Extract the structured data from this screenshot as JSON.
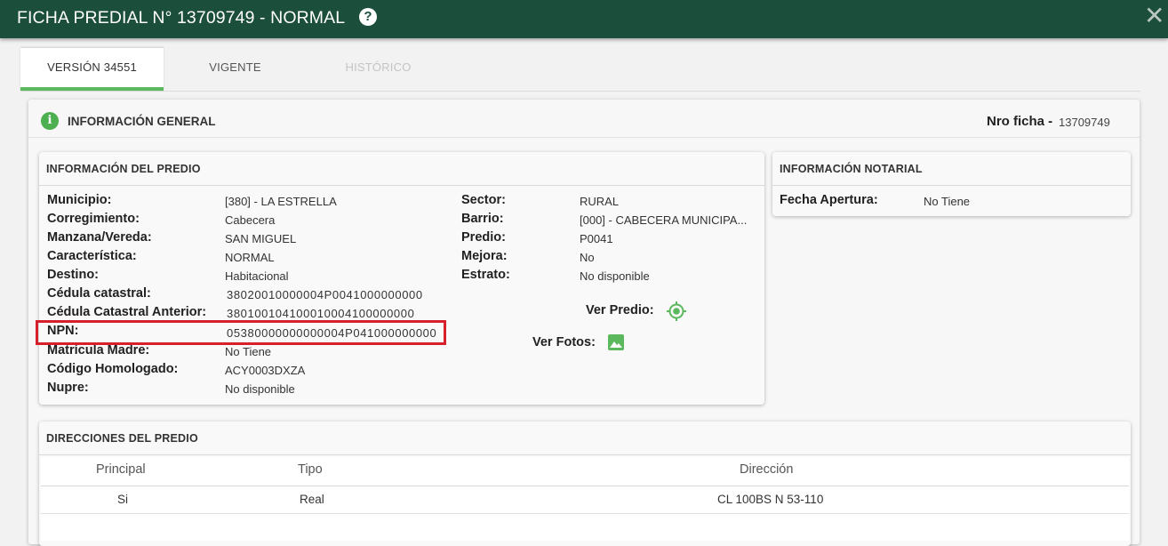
{
  "header": {
    "title": "FICHA PREDIAL N° 13709749 - NORMAL",
    "help_icon": "?",
    "close_icon": "✕"
  },
  "tabs": [
    {
      "label": "VERSIÓN 34551",
      "active": true
    },
    {
      "label": "VIGENTE",
      "active": false
    },
    {
      "label": "HISTÓRICO",
      "active": false,
      "disabled": true
    }
  ],
  "general": {
    "title": "INFORMACIÓN GENERAL",
    "icon": "info-icon",
    "nro_ficha_label": "Nro ficha -",
    "nro_ficha_value": "13709749"
  },
  "predio": {
    "title": "INFORMACIÓN DEL PREDIO",
    "left_fields": [
      {
        "label": "Municipio:",
        "value": "[380] - LA ESTRELLA"
      },
      {
        "label": "Corregimiento:",
        "value": "Cabecera"
      },
      {
        "label": "Manzana/Vereda:",
        "value": "SAN MIGUEL"
      },
      {
        "label": "Característica:",
        "value": "NORMAL"
      },
      {
        "label": "Destino:",
        "value": "Habitacional"
      },
      {
        "label": "Cédula catastral:",
        "value": "38020010000004P0041000000000"
      },
      {
        "label": "Cédula Catastral Anterior:",
        "value": "380100104100010004100000000"
      },
      {
        "label": "NPN:",
        "value": "05380000000000004P041000000000"
      },
      {
        "label": "Matrícula Madre:",
        "value": "No Tiene"
      },
      {
        "label": "Código Homologado:",
        "value": "ACY0003DXZA"
      },
      {
        "label": "Nupre:",
        "value": "No disponible"
      }
    ],
    "right_fields": [
      {
        "label": "Sector:",
        "value": "RURAL"
      },
      {
        "label": "Barrio:",
        "value": "[000] - CABECERA MUNICIPA..."
      },
      {
        "label": "Predio:",
        "value": "P0041"
      },
      {
        "label": "Mejora:",
        "value": "No"
      },
      {
        "label": "Estrato:",
        "value": "No disponible"
      }
    ],
    "ver_predio": "Ver Predio:",
    "ver_fotos": "Ver Fotos:",
    "accent": "#5cb85c",
    "highlight_color": "#d6202b"
  },
  "notarial": {
    "title": "INFORMACIÓN NOTARIAL",
    "fields": [
      {
        "label": "Fecha Apertura:",
        "value": "No Tiene"
      }
    ]
  },
  "direcciones": {
    "title": "DIRECCIONES DEL PREDIO",
    "columns": [
      "Principal",
      "Tipo",
      "Dirección"
    ],
    "rows": [
      [
        "Si",
        "Real",
        "CL 100BS N 53-110"
      ]
    ]
  },
  "colors": {
    "header_bg": "#1b4e3b",
    "tab_active_underline": "#5cb85c",
    "info_icon": "#4caf50"
  }
}
